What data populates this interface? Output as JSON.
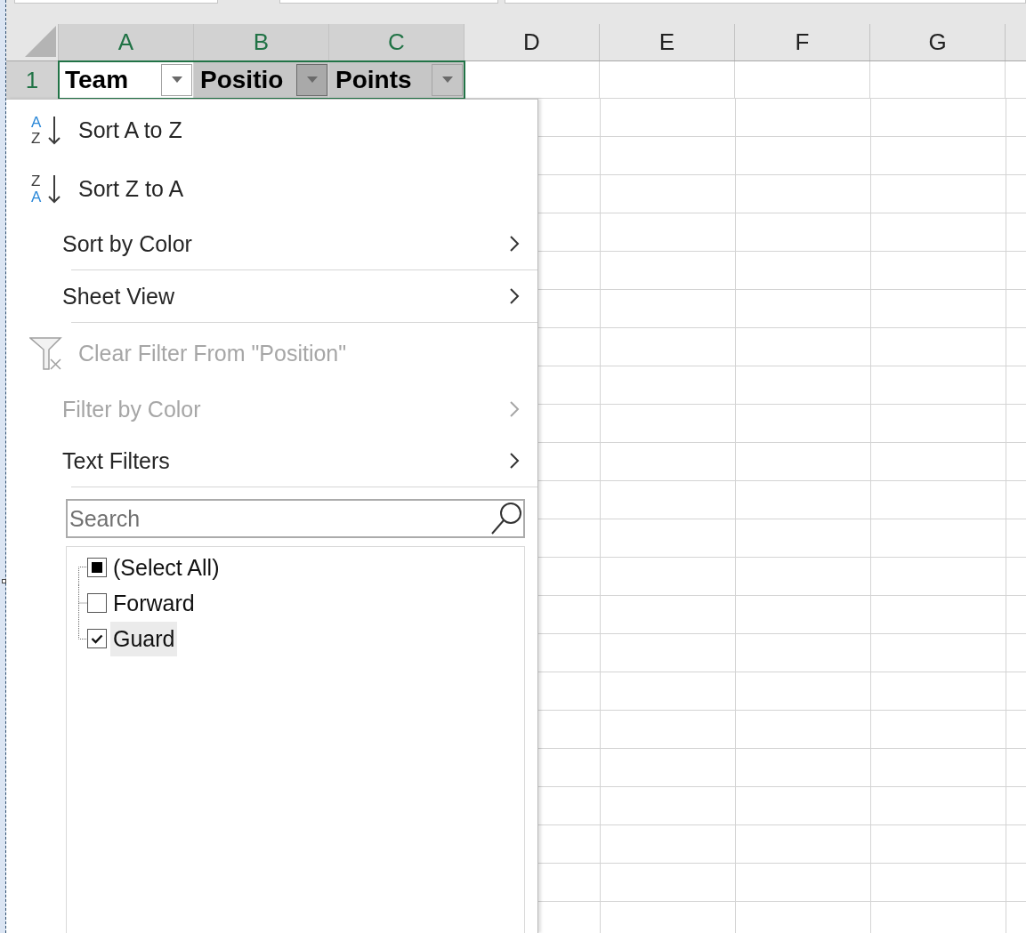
{
  "column_headers": [
    {
      "label": "A",
      "selected": true
    },
    {
      "label": "B",
      "selected": true
    },
    {
      "label": "C",
      "selected": true
    },
    {
      "label": "D",
      "selected": false
    },
    {
      "label": "E",
      "selected": false
    },
    {
      "label": "F",
      "selected": false
    },
    {
      "label": "G",
      "selected": false
    }
  ],
  "rows": [
    {
      "header": {
        "label": "1",
        "selected": true
      },
      "cells": [
        {
          "text": "Team",
          "active": true,
          "filter_open": false
        },
        {
          "text": "Positio",
          "active": false,
          "filter_open": true
        },
        {
          "text": "Points",
          "active": false,
          "filter_open": false
        }
      ]
    }
  ],
  "filter_menu": {
    "items": [
      {
        "kind": "sort-ascending",
        "label": "Sort A to Z",
        "icon_letters": [
          "A",
          "Z"
        ],
        "disabled": false,
        "separator_after": false
      },
      {
        "kind": "sort-descending",
        "label": "Sort Z to A",
        "icon_letters": [
          "Z",
          "A"
        ],
        "disabled": false,
        "separator_after": false
      },
      {
        "kind": "submenu",
        "label": "Sort by Color",
        "disabled": false,
        "separator_after": true
      },
      {
        "kind": "submenu",
        "label": "Sheet View",
        "disabled": false,
        "separator_after": true
      },
      {
        "kind": "clear-filter",
        "label": "Clear Filter From \"Position\"",
        "disabled": true,
        "separator_after": false
      },
      {
        "kind": "submenu",
        "label": "Filter by Color",
        "disabled": true,
        "separator_after": false
      },
      {
        "kind": "submenu",
        "label": "Text Filters",
        "disabled": false,
        "separator_after": true
      }
    ],
    "search": {
      "placeholder": "Search"
    },
    "select_all": {
      "label": "(Select All)",
      "partial": true,
      "selected": false
    },
    "values": [
      {
        "label": "Forward",
        "checked": false,
        "selected": false
      },
      {
        "label": "Guard",
        "checked": true,
        "selected": true
      }
    ]
  }
}
